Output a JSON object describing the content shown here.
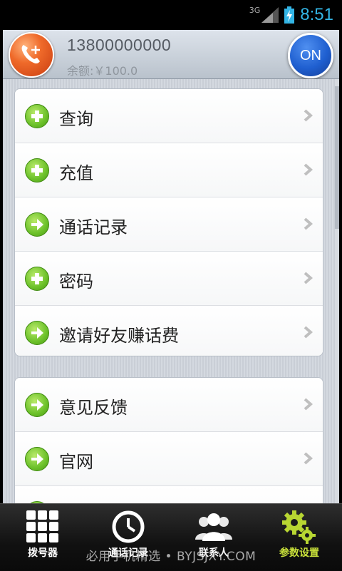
{
  "status_bar": {
    "network": "3G",
    "time": "8:51"
  },
  "header": {
    "phone_number": "13800000000",
    "balance_text": "余额:￥100.0",
    "on_button": "ON"
  },
  "menu_group_1": [
    {
      "label": "查询",
      "icon": "plus-circle-icon"
    },
    {
      "label": "充值",
      "icon": "plus-circle-icon"
    },
    {
      "label": "通话记录",
      "icon": "arrow-circle-icon"
    },
    {
      "label": "密码",
      "icon": "plus-circle-icon"
    },
    {
      "label": "邀请好友赚话费",
      "icon": "arrow-circle-icon"
    }
  ],
  "menu_group_2": [
    {
      "label": "意见反馈",
      "icon": "arrow-circle-icon"
    },
    {
      "label": "官网",
      "icon": "arrow-circle-icon"
    },
    {
      "label": "",
      "icon": "arrow-circle-icon"
    }
  ],
  "bottom_nav": [
    {
      "label": "拨号器",
      "icon": "dialpad-icon",
      "active": false
    },
    {
      "label": "通话记录",
      "icon": "clock-icon",
      "active": false
    },
    {
      "label": "联系人",
      "icon": "contacts-icon",
      "active": false
    },
    {
      "label": "参数设置",
      "icon": "gear-icon",
      "active": true
    }
  ],
  "watermark": "必用手机精选 • BYJSJXY.COM",
  "colors": {
    "accent_green": "#6cc12a",
    "active_tab": "#c8e03a",
    "on_button": "#1f5fd0",
    "logo": "#ef6a2a"
  }
}
